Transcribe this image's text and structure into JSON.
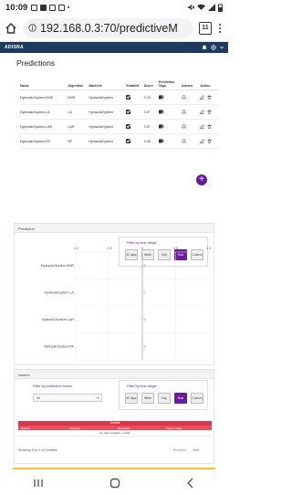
{
  "status": {
    "time": "10:09"
  },
  "browser": {
    "url": "192.168.0.3:70/predictiveM",
    "tab_count": "11"
  },
  "app": {
    "brand": "ADISRA"
  },
  "page_title": "Predictions",
  "predictions": {
    "columns": [
      "Name",
      "Algorithm",
      "Machine",
      "Enabled",
      "Score",
      "Prediction Tags",
      "Alarms",
      "Action"
    ],
    "rows": [
      {
        "name": "HydraulicSystem-KMR",
        "algorithm": "KMR",
        "machine": "HydraulicSystem",
        "score": "0.43"
      },
      {
        "name": "HydraulicSystem-LA",
        "algorithm": "LA",
        "machine": "HydraulicSystem",
        "score": "0.97"
      },
      {
        "name": "HydraulicSystem-LAR",
        "algorithm": "LAR",
        "machine": "HydraulicSystem",
        "score": "0.97"
      },
      {
        "name": "HydraulicSystem-RF",
        "algorithm": "RF",
        "machine": "HydraulicSystem",
        "score": "0.98"
      }
    ]
  },
  "prediction_section": {
    "title": "Prediction",
    "filter_label": "Filter by time range:",
    "buttons": [
      "30 days",
      "Week",
      "Day",
      "Now",
      "Custom"
    ],
    "active": "Now"
  },
  "chart_data": {
    "type": "bar",
    "orientation": "horizontal",
    "categories": [
      "HydraulicSystem-KMR",
      "HydraulicSystem-LA",
      "HydraulicSystem-LAR",
      "HydraulicSystem-RF"
    ],
    "values": [
      0,
      0,
      0,
      0
    ],
    "xlim": [
      -1,
      1
    ],
    "x_ticks": [
      "-1.0",
      "-0.5",
      "0",
      "0.5",
      "1.0"
    ],
    "value_labels": [
      "0",
      "0",
      "0",
      "0"
    ],
    "grid": true
  },
  "alarms_section": {
    "title": "Alarms",
    "model_filter_label": "Filter by prediction model:",
    "model_selected": "All",
    "filter_label": "Filter by time range:",
    "buttons": [
      "30 days",
      "Week",
      "Day",
      "Now",
      "Custom"
    ],
    "active": "Now",
    "table_title": "Default",
    "columns": [
      "Source",
      "Message",
      "Recorded",
      "Time to reset"
    ],
    "empty": "No data available in table",
    "showing": "Showing 0 to 0 of 0 entries",
    "prev": "Previous",
    "next": "Next"
  }
}
